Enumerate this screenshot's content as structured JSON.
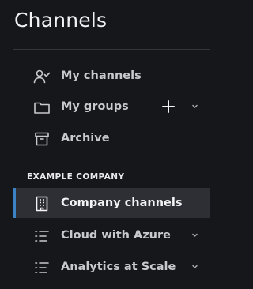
{
  "header": {
    "title": "Channels"
  },
  "nav": {
    "my_channels": {
      "label": "My channels",
      "icon": "user-check-icon"
    },
    "my_groups": {
      "label": "My groups",
      "icon": "folder-icon"
    },
    "archive": {
      "label": "Archive",
      "icon": "archive-box-icon"
    }
  },
  "section": {
    "label": "EXAMPLE COMPANY"
  },
  "company": {
    "company_channels": {
      "label": "Company channels",
      "icon": "building-icon",
      "selected": true
    },
    "groups": [
      {
        "label": "Cloud with Azure",
        "icon": "list-icon"
      },
      {
        "label": "Analytics at Scale",
        "icon": "list-icon"
      }
    ]
  },
  "colors": {
    "background": "#16171b",
    "selected_background": "#2e2f34",
    "accent": "#3b82c4",
    "text": "#c8c9cd"
  }
}
